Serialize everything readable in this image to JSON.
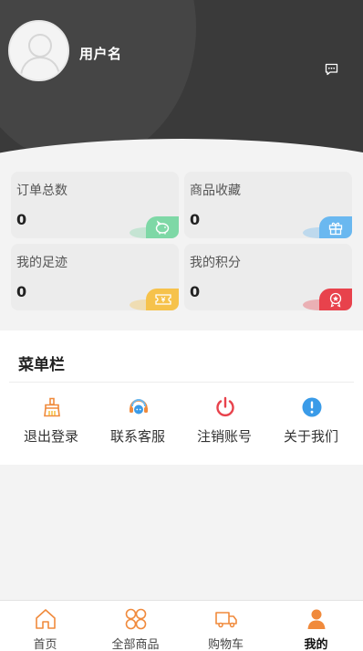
{
  "header": {
    "username": "用户名",
    "message_icon": "message-icon",
    "avatar_icon": "user-avatar-icon"
  },
  "stats": [
    {
      "label": "订单总数",
      "value": "0",
      "icon": "piggy-bank-icon",
      "color": "#7ed8a6"
    },
    {
      "label": "商品收藏",
      "value": "0",
      "icon": "gift-icon",
      "color": "#6ab8f0"
    },
    {
      "label": "我的足迹",
      "value": "0",
      "icon": "coupon-icon",
      "color": "#f6c24b"
    },
    {
      "label": "我的积分",
      "value": "0",
      "icon": "medal-icon",
      "color": "#e8424c"
    }
  ],
  "menu": {
    "title": "菜单栏",
    "items": [
      {
        "label": "退出登录",
        "icon": "broom-icon"
      },
      {
        "label": "联系客服",
        "icon": "headset-icon"
      },
      {
        "label": "注销账号",
        "icon": "power-icon"
      },
      {
        "label": "关于我们",
        "icon": "info-icon"
      }
    ]
  },
  "tabbar": [
    {
      "label": "首页",
      "icon": "home-icon",
      "active": false
    },
    {
      "label": "全部商品",
      "icon": "grid-icon",
      "active": false
    },
    {
      "label": "购物车",
      "icon": "truck-icon",
      "active": false
    },
    {
      "label": "我的",
      "icon": "person-icon",
      "active": true
    }
  ],
  "colors": {
    "accent": "#f08a3c",
    "header_bg": "#3a3a3a"
  }
}
